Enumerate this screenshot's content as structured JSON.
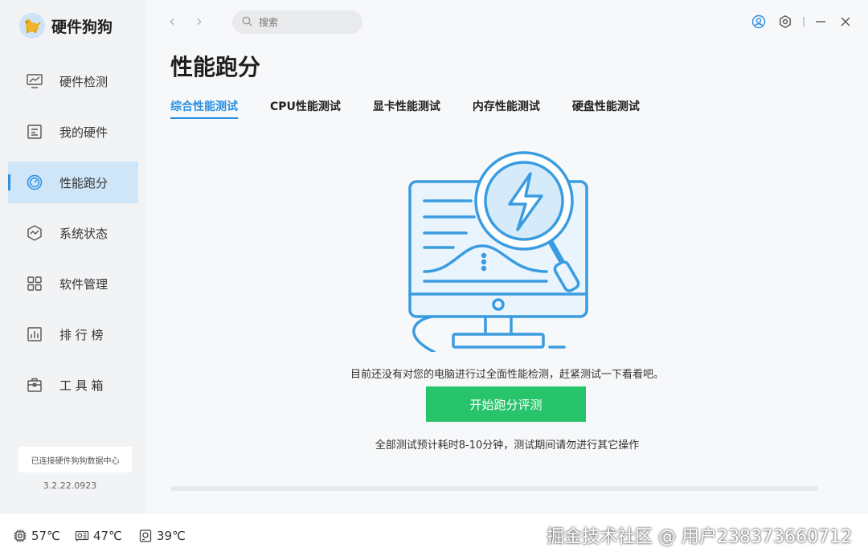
{
  "app": {
    "name": "硬件狗狗",
    "version": "3.2.22.0923"
  },
  "sidebar": {
    "items": [
      {
        "label": "硬件检测",
        "icon": "monitor-chart-icon"
      },
      {
        "label": "我的硬件",
        "icon": "hardware-board-icon"
      },
      {
        "label": "性能跑分",
        "icon": "speedometer-icon",
        "active": true
      },
      {
        "label": "系统状态",
        "icon": "system-status-icon"
      },
      {
        "label": "软件管理",
        "icon": "apps-grid-icon"
      },
      {
        "label": "排 行 榜",
        "icon": "ranking-icon"
      },
      {
        "label": "工 具 箱",
        "icon": "toolbox-icon"
      }
    ],
    "connect_text": "已连接硬件狗狗数据中心"
  },
  "search": {
    "placeholder": "搜索"
  },
  "page": {
    "title": "性能跑分",
    "tabs": [
      {
        "label": "综合性能测试",
        "active": true
      },
      {
        "label": "CPU性能测试"
      },
      {
        "label": "显卡性能测试"
      },
      {
        "label": "内存性能测试"
      },
      {
        "label": "硬盘性能测试"
      }
    ],
    "message": "目前还没有对您的电脑进行过全面性能检测，赶紧测试一下看看吧。",
    "start_button": "开始跑分评测",
    "note": "全部测试预计耗时8-10分钟，测试期间请勿进行其它操作"
  },
  "status": {
    "cpu_temp": "57℃",
    "gpu_temp": "47℃",
    "disk_temp": "39℃"
  },
  "watermark": "掘金技术社区 @ 用户238373660712",
  "colors": {
    "accent": "#2d8fe0",
    "start_button": "#27c46b",
    "active_nav_bg": "#cfe6f8"
  }
}
